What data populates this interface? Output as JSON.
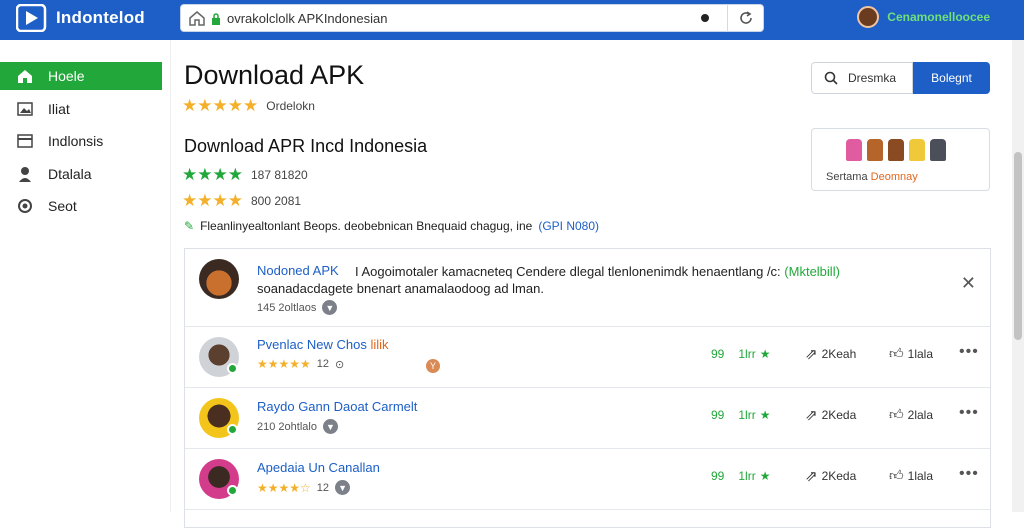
{
  "app": {
    "logo_text": "Indontelod",
    "brand_color": "#1d5fc6",
    "accent_color": "#22a83a"
  },
  "browser": {
    "url": "ovrakolclolk APKIndonesian",
    "user_name": "Cenamonelloocee"
  },
  "sidebar": {
    "items": [
      {
        "label": "Hoele",
        "icon": "home-icon",
        "active": true
      },
      {
        "label": "Iliat",
        "icon": "image-icon",
        "active": false
      },
      {
        "label": "Indlonsis",
        "icon": "list-icon",
        "active": false
      },
      {
        "label": "Dtalala",
        "icon": "user-icon",
        "active": false
      },
      {
        "label": "Seot",
        "icon": "settings-icon",
        "active": false
      }
    ]
  },
  "main": {
    "title": "Download APK",
    "rating_text": "Ordelokn",
    "subtitle": "Download APR Incd Indonesia",
    "rating2_text": "187 81820",
    "rating3_text": "800 2081",
    "note_text": "Fleanlinyealtonlant Beops. deobebnican Bnequaid chagug, ine",
    "note_link": "(GPI N080)"
  },
  "actions": {
    "search_label": "Dresmka",
    "primary_label": "Bolegnt"
  },
  "promo": {
    "caption_prefix": "Sertama",
    "caption_highlight": "Deomnay"
  },
  "comments": {
    "featured": {
      "title": "Nodoned APK",
      "text_line1": "I Aogoimotaler kamacneteq Cendere dlegal tlenlonenimdk henaentlang /c:",
      "highlight": "(Mktelbill)",
      "text_line2": "soanadacdagete bnenart anamalaodoog ad lman.",
      "meta": "145 2oltlaos",
      "close_icon": "close-icon"
    },
    "rows": [
      {
        "title": "Pvenlac New Chos",
        "tag": "lilik",
        "rating": "12",
        "meta": "",
        "likes": "99",
        "reply_label": "1lrr",
        "share": "2Keah",
        "like_label": "1lala"
      },
      {
        "title": "Raydo Gann Daoat Carmelt",
        "tag": "",
        "rating": "",
        "meta": "210 2ohtlalo",
        "likes": "99",
        "reply_label": "1lrr",
        "share": "2Keda",
        "like_label": "2lala"
      },
      {
        "title": "Apedaia Un Canallan",
        "tag": "",
        "rating": "12",
        "meta": "",
        "likes": "99",
        "reply_label": "1lrr",
        "share": "2Keda",
        "like_label": "1lala"
      }
    ]
  }
}
